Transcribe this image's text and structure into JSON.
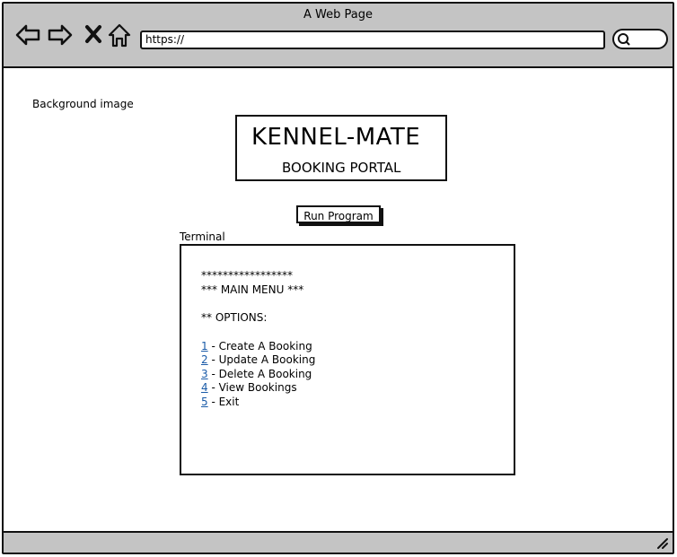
{
  "window": {
    "title": "A Web Page"
  },
  "toolbar": {
    "url": "https://",
    "icons": [
      "back-arrow-icon",
      "forward-arrow-icon",
      "close-x-icon",
      "home-icon",
      "search-icon"
    ]
  },
  "page": {
    "background_label": "Background image",
    "logo": {
      "title": "KENNEL-MATE",
      "subtitle": "BOOKING PORTAL"
    },
    "run_button": "Run Program",
    "terminal_label": "Terminal",
    "terminal": {
      "stars": "*****************",
      "menu_title": "*** MAIN MENU ***",
      "options_heading": "** OPTIONS:",
      "options": [
        {
          "num": "1",
          "text": " - Create A Booking"
        },
        {
          "num": "2",
          "text": " - Update A Booking"
        },
        {
          "num": "3",
          "text": " - Delete A Booking"
        },
        {
          "num": "4",
          "text": " - View Bookings"
        },
        {
          "num": "5",
          "text": " - Exit"
        }
      ]
    }
  },
  "colors": {
    "chrome": "#c4c4c4",
    "link": "#1a5ba8",
    "border": "#111111"
  }
}
